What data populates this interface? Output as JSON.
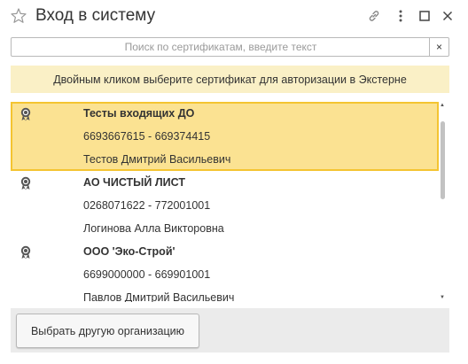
{
  "window": {
    "title": "Вход в систему",
    "icons": {
      "favorite": "star-icon",
      "link": "link-icon",
      "more": "more-vertical-icon",
      "maximize": "maximize-icon",
      "close": "close-icon"
    }
  },
  "search": {
    "placeholder": "Поиск по сертификатам, введите текст",
    "value": "",
    "clear_label": "×"
  },
  "hint": {
    "text": "Двойным кликом выберите сертификат для авторизации в Экстерне"
  },
  "certificates": [
    {
      "name": "Тесты входящих ДО",
      "codes": "6693667615 - 669374415",
      "person": "Тестов Дмитрий Васильевич",
      "selected": true
    },
    {
      "name": "АО ЧИСТЫЙ ЛИСТ",
      "codes": "0268071622 - 772001001",
      "person": "Логинова Алла Викторовна",
      "selected": false
    },
    {
      "name": "ООО 'Эко-Строй'",
      "codes": "6699000000 - 669901001",
      "person": "Павлов Дмитрий Васильевич",
      "selected": false
    }
  ],
  "footer": {
    "other_org_button": "Выбрать другую организацию"
  },
  "colors": {
    "selected_bg": "#fbe292",
    "selected_border": "#f4c431",
    "hint_bg": "#faf0c6",
    "footer_bg": "#ebebeb"
  }
}
